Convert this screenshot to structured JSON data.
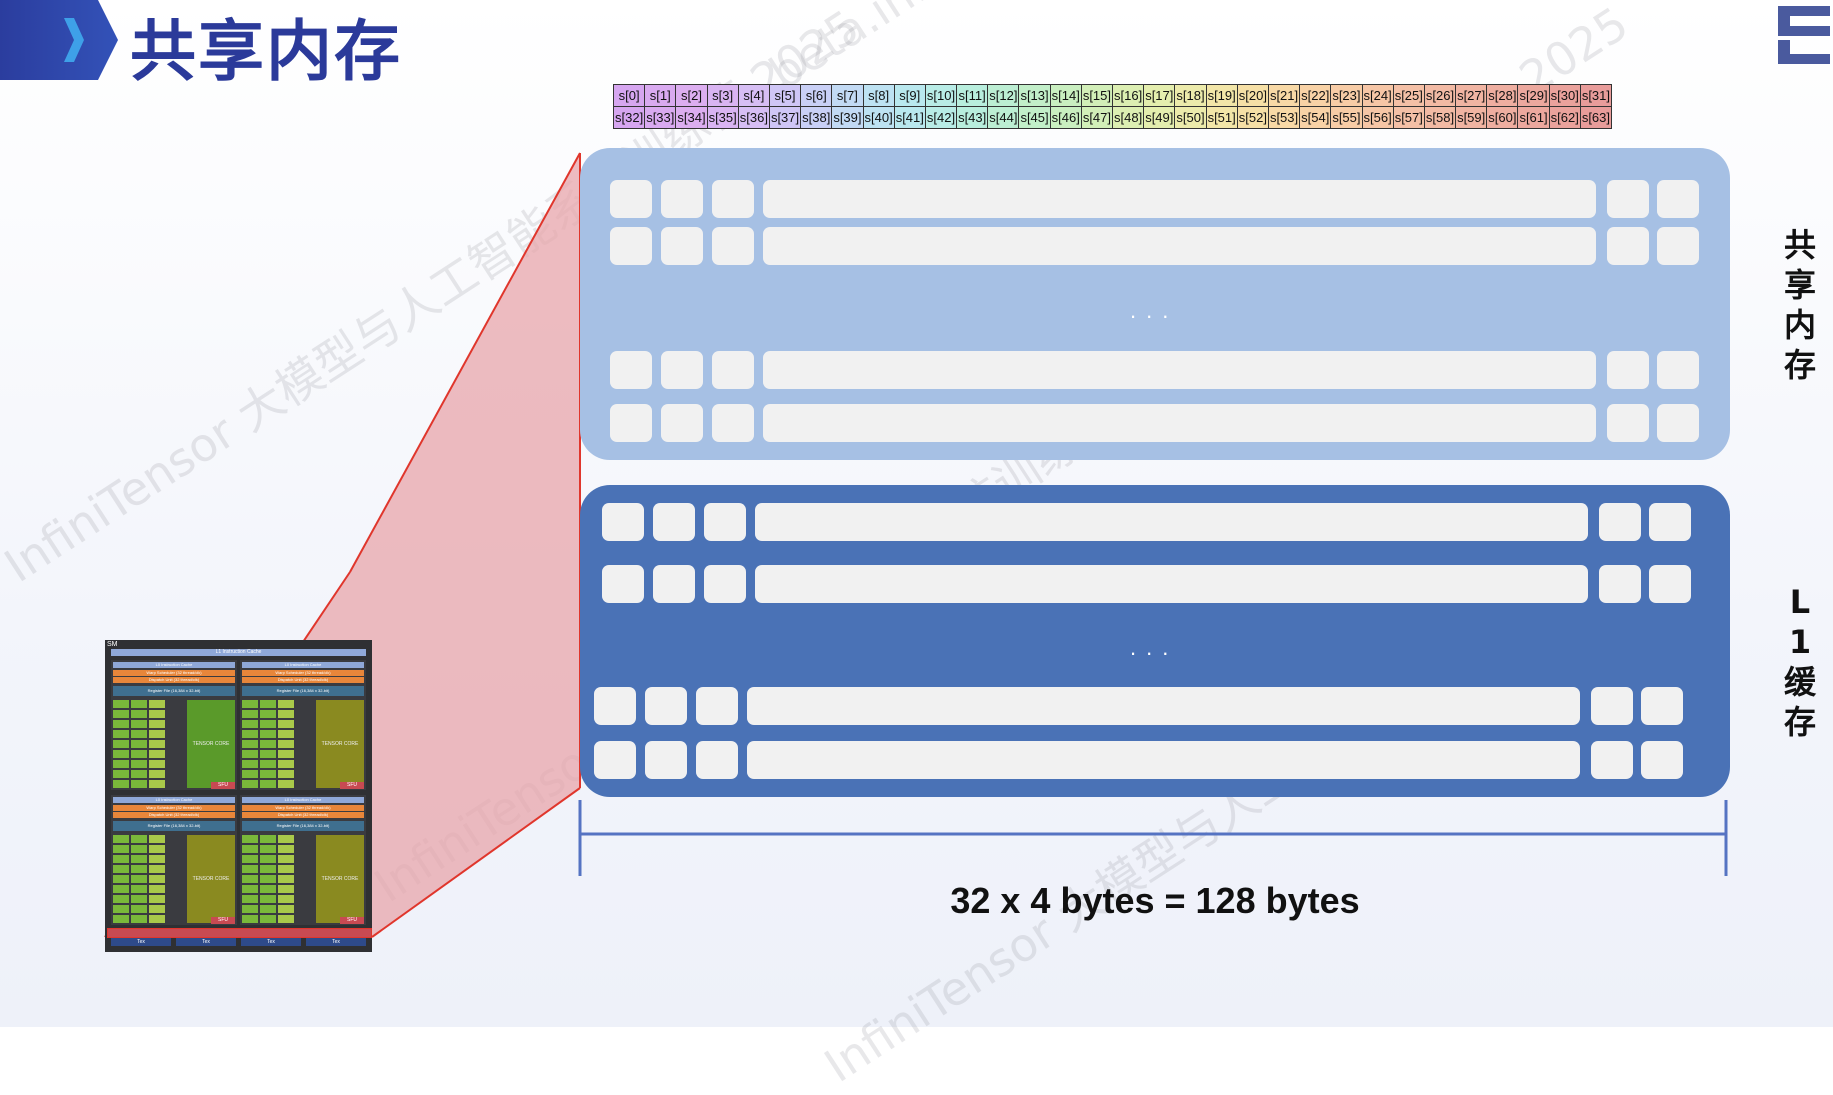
{
  "header": {
    "title": "共享内存"
  },
  "watermarks": [
    "InfiniTensor 大模型与人工智能系统训练营 2025",
    "InfiniTensor 大模型与人工智能系统训练营 2025",
    "InfiniTensor 大模型与人工智能系统训练营 2025",
    "beta.infini",
    "2025"
  ],
  "index_table": {
    "row1": [
      "s[0]",
      "s[1]",
      "s[2]",
      "s[3]",
      "s[4]",
      "s[5]",
      "s[6]",
      "s[7]",
      "s[8]",
      "s[9]",
      "s[10]",
      "s[11]",
      "s[12]",
      "s[13]",
      "s[14]",
      "s[15]",
      "s[16]",
      "s[17]",
      "s[18]",
      "s[19]",
      "s[20]",
      "s[21]",
      "s[22]",
      "s[23]",
      "s[24]",
      "s[25]",
      "s[26]",
      "s[27]",
      "s[28]",
      "s[29]",
      "s[30]",
      "s[31]"
    ],
    "row2": [
      "s[32]",
      "s[33]",
      "s[34]",
      "s[35]",
      "s[36]",
      "s[37]",
      "s[38]",
      "s[39]",
      "s[40]",
      "s[41]",
      "s[42]",
      "s[43]",
      "s[44]",
      "s[45]",
      "s[46]",
      "s[47]",
      "s[48]",
      "s[49]",
      "s[50]",
      "s[51]",
      "s[52]",
      "s[53]",
      "s[54]",
      "s[55]",
      "s[56]",
      "s[57]",
      "s[58]",
      "s[59]",
      "s[60]",
      "s[61]",
      "s[62]",
      "s[63]"
    ],
    "colors": [
      "#d6a6f0",
      "#d9aaf0",
      "#dcaef0",
      "#d9b4f2",
      "#d6bef4",
      "#cfc6f6",
      "#c9d0f6",
      "#c2daf4",
      "#bde2f2",
      "#b9e8ee",
      "#b8ece6",
      "#b8eedd",
      "#bceed3",
      "#c2efc9",
      "#c9efc0",
      "#d2efb8",
      "#dcefb2",
      "#e4eeae",
      "#ecebab",
      "#f2e6a8",
      "#f6e0a6",
      "#f8d9a6",
      "#f8d2a6",
      "#f7cca6",
      "#f6c6a6",
      "#f4c0a6",
      "#f2baa4",
      "#f0b4a2",
      "#eeaea0",
      "#eca89e",
      "#eaa29c",
      "#e89c9a"
    ]
  },
  "diagram": {
    "shared_memory_label": "共享内存",
    "l1_cache_label": "L1缓存",
    "ellipsis": "...",
    "bytes_label": "32 x 4 bytes = 128 bytes",
    "colors": {
      "shared_panel": "#a6c0e4",
      "l1_panel": "#4a72b6",
      "highlight": "#e8a5ab",
      "highlight_line": "#e0362c",
      "bracket": "#5573c2"
    }
  },
  "sm_thumbnail": {
    "label": "SM",
    "l1_instruction_cache": "L1 Instruction Cache",
    "l0_instruction_cache": "L0 Instruction Cache",
    "warp_scheduler": "Warp Scheduler (32 thread/clk)",
    "dispatch_unit": "Dispatch Unit (32 thread/clk)",
    "register_file": "Register File (16,384 x 32-bit)",
    "tensor_core": "TENSOR CORE",
    "sfu": "SFU",
    "bottom_units": [
      "Tex",
      "Tex",
      "Tex",
      "Tex"
    ]
  }
}
